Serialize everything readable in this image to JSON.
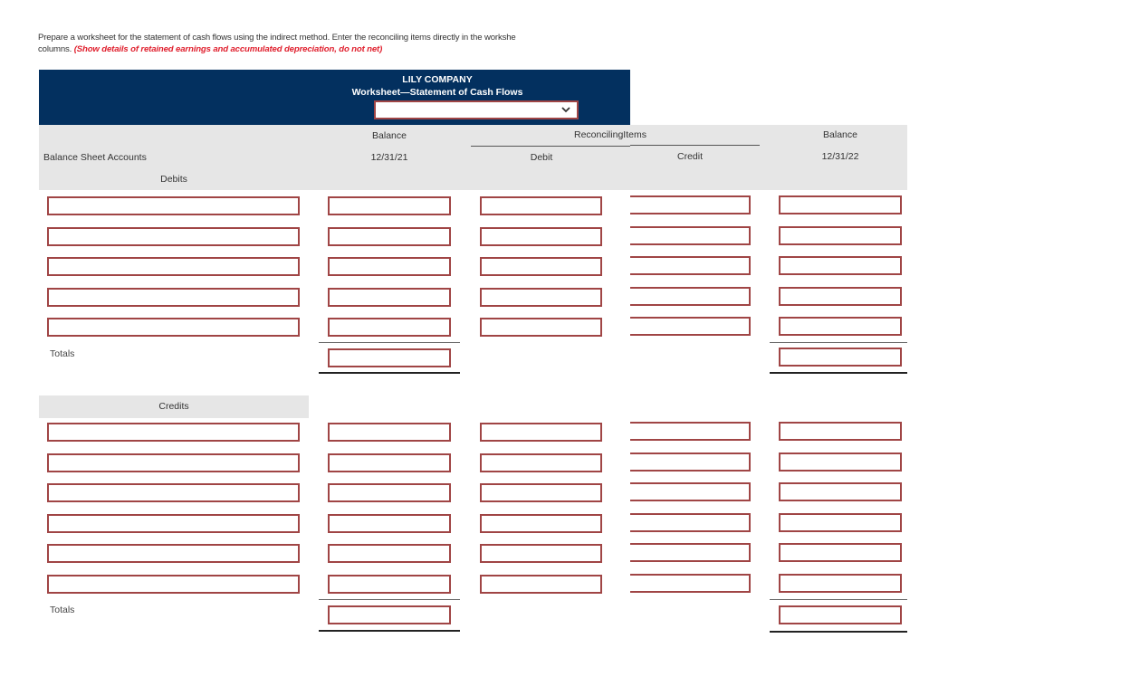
{
  "instructions": {
    "text": "Prepare a worksheet for the statement of cash flows using the indirect method. Enter the reconciling items directly in the workshe",
    "text_line2": "columns.",
    "note": "(Show details of retained earnings and accumulated depreciation, do not net)"
  },
  "header": {
    "company": "LILY COMPANY",
    "title": "Worksheet—Statement of Cash Flows",
    "date_select": {
      "value": "",
      "icon": "chevron-down-icon"
    }
  },
  "columns": {
    "accounts": "Balance Sheet Accounts",
    "debits_section": "Debits",
    "balance_start_label": "Balance",
    "balance_start_date": "12/31/21",
    "reconciling_label": "Reconciling",
    "reconciling_label2": "Items",
    "debit": "Debit",
    "credit": "Credit",
    "balance_end_label": "Balance",
    "balance_end_date": "12/31/22"
  },
  "debits": {
    "rows": [
      {
        "account": "",
        "balance_start": "",
        "debit": "",
        "credit": "",
        "balance_end": ""
      },
      {
        "account": "",
        "balance_start": "",
        "debit": "",
        "credit": "",
        "balance_end": ""
      },
      {
        "account": "",
        "balance_start": "",
        "debit": "",
        "credit": "",
        "balance_end": ""
      },
      {
        "account": "",
        "balance_start": "",
        "debit": "",
        "credit": "",
        "balance_end": ""
      },
      {
        "account": "",
        "balance_start": "",
        "debit": "",
        "credit": "",
        "balance_end": ""
      }
    ],
    "totals_label": "Totals",
    "totals": {
      "balance_start": "",
      "balance_end": ""
    }
  },
  "credits": {
    "section_label": "Credits",
    "rows": [
      {
        "account": "",
        "balance_start": "",
        "debit": "",
        "credit": "",
        "balance_end": ""
      },
      {
        "account": "",
        "balance_start": "",
        "debit": "",
        "credit": "",
        "balance_end": ""
      },
      {
        "account": "",
        "balance_start": "",
        "debit": "",
        "credit": "",
        "balance_end": ""
      },
      {
        "account": "",
        "balance_start": "",
        "debit": "",
        "credit": "",
        "balance_end": ""
      },
      {
        "account": "",
        "balance_start": "",
        "debit": "",
        "credit": "",
        "balance_end": ""
      },
      {
        "account": "",
        "balance_start": "",
        "debit": "",
        "credit": "",
        "balance_end": ""
      }
    ],
    "totals_label": "Totals",
    "totals": {
      "balance_start": "",
      "balance_end": ""
    }
  },
  "colors": {
    "header_bg": "#03305f",
    "input_border": "#a04545",
    "note_red": "#e0202e",
    "column_header_bg": "#e6e6e6"
  }
}
